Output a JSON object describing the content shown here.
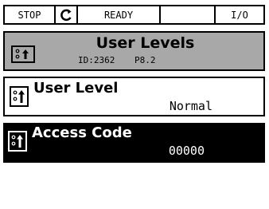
{
  "status_bar": {
    "mode": "STOP",
    "state": "READY",
    "location": "I/O"
  },
  "header": {
    "title": "User Levels",
    "id_label": "ID:2362",
    "param_label": "P8.2"
  },
  "items": [
    {
      "label": "User Level",
      "value": "Normal",
      "selected": false
    },
    {
      "label": "Access Code",
      "value": "00000",
      "selected": true
    }
  ]
}
